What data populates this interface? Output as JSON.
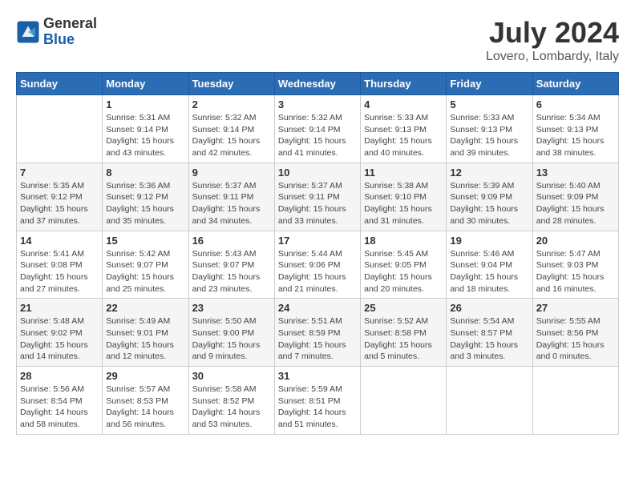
{
  "logo": {
    "general": "General",
    "blue": "Blue"
  },
  "title": {
    "month_year": "July 2024",
    "location": "Lovero, Lombardy, Italy"
  },
  "headers": [
    "Sunday",
    "Monday",
    "Tuesday",
    "Wednesday",
    "Thursday",
    "Friday",
    "Saturday"
  ],
  "weeks": [
    [
      {
        "day": "",
        "info": ""
      },
      {
        "day": "1",
        "info": "Sunrise: 5:31 AM\nSunset: 9:14 PM\nDaylight: 15 hours\nand 43 minutes."
      },
      {
        "day": "2",
        "info": "Sunrise: 5:32 AM\nSunset: 9:14 PM\nDaylight: 15 hours\nand 42 minutes."
      },
      {
        "day": "3",
        "info": "Sunrise: 5:32 AM\nSunset: 9:14 PM\nDaylight: 15 hours\nand 41 minutes."
      },
      {
        "day": "4",
        "info": "Sunrise: 5:33 AM\nSunset: 9:13 PM\nDaylight: 15 hours\nand 40 minutes."
      },
      {
        "day": "5",
        "info": "Sunrise: 5:33 AM\nSunset: 9:13 PM\nDaylight: 15 hours\nand 39 minutes."
      },
      {
        "day": "6",
        "info": "Sunrise: 5:34 AM\nSunset: 9:13 PM\nDaylight: 15 hours\nand 38 minutes."
      }
    ],
    [
      {
        "day": "7",
        "info": "Sunrise: 5:35 AM\nSunset: 9:12 PM\nDaylight: 15 hours\nand 37 minutes."
      },
      {
        "day": "8",
        "info": "Sunrise: 5:36 AM\nSunset: 9:12 PM\nDaylight: 15 hours\nand 35 minutes."
      },
      {
        "day": "9",
        "info": "Sunrise: 5:37 AM\nSunset: 9:11 PM\nDaylight: 15 hours\nand 34 minutes."
      },
      {
        "day": "10",
        "info": "Sunrise: 5:37 AM\nSunset: 9:11 PM\nDaylight: 15 hours\nand 33 minutes."
      },
      {
        "day": "11",
        "info": "Sunrise: 5:38 AM\nSunset: 9:10 PM\nDaylight: 15 hours\nand 31 minutes."
      },
      {
        "day": "12",
        "info": "Sunrise: 5:39 AM\nSunset: 9:09 PM\nDaylight: 15 hours\nand 30 minutes."
      },
      {
        "day": "13",
        "info": "Sunrise: 5:40 AM\nSunset: 9:09 PM\nDaylight: 15 hours\nand 28 minutes."
      }
    ],
    [
      {
        "day": "14",
        "info": "Sunrise: 5:41 AM\nSunset: 9:08 PM\nDaylight: 15 hours\nand 27 minutes."
      },
      {
        "day": "15",
        "info": "Sunrise: 5:42 AM\nSunset: 9:07 PM\nDaylight: 15 hours\nand 25 minutes."
      },
      {
        "day": "16",
        "info": "Sunrise: 5:43 AM\nSunset: 9:07 PM\nDaylight: 15 hours\nand 23 minutes."
      },
      {
        "day": "17",
        "info": "Sunrise: 5:44 AM\nSunset: 9:06 PM\nDaylight: 15 hours\nand 21 minutes."
      },
      {
        "day": "18",
        "info": "Sunrise: 5:45 AM\nSunset: 9:05 PM\nDaylight: 15 hours\nand 20 minutes."
      },
      {
        "day": "19",
        "info": "Sunrise: 5:46 AM\nSunset: 9:04 PM\nDaylight: 15 hours\nand 18 minutes."
      },
      {
        "day": "20",
        "info": "Sunrise: 5:47 AM\nSunset: 9:03 PM\nDaylight: 15 hours\nand 16 minutes."
      }
    ],
    [
      {
        "day": "21",
        "info": "Sunrise: 5:48 AM\nSunset: 9:02 PM\nDaylight: 15 hours\nand 14 minutes."
      },
      {
        "day": "22",
        "info": "Sunrise: 5:49 AM\nSunset: 9:01 PM\nDaylight: 15 hours\nand 12 minutes."
      },
      {
        "day": "23",
        "info": "Sunrise: 5:50 AM\nSunset: 9:00 PM\nDaylight: 15 hours\nand 9 minutes."
      },
      {
        "day": "24",
        "info": "Sunrise: 5:51 AM\nSunset: 8:59 PM\nDaylight: 15 hours\nand 7 minutes."
      },
      {
        "day": "25",
        "info": "Sunrise: 5:52 AM\nSunset: 8:58 PM\nDaylight: 15 hours\nand 5 minutes."
      },
      {
        "day": "26",
        "info": "Sunrise: 5:54 AM\nSunset: 8:57 PM\nDaylight: 15 hours\nand 3 minutes."
      },
      {
        "day": "27",
        "info": "Sunrise: 5:55 AM\nSunset: 8:56 PM\nDaylight: 15 hours\nand 0 minutes."
      }
    ],
    [
      {
        "day": "28",
        "info": "Sunrise: 5:56 AM\nSunset: 8:54 PM\nDaylight: 14 hours\nand 58 minutes."
      },
      {
        "day": "29",
        "info": "Sunrise: 5:57 AM\nSunset: 8:53 PM\nDaylight: 14 hours\nand 56 minutes."
      },
      {
        "day": "30",
        "info": "Sunrise: 5:58 AM\nSunset: 8:52 PM\nDaylight: 14 hours\nand 53 minutes."
      },
      {
        "day": "31",
        "info": "Sunrise: 5:59 AM\nSunset: 8:51 PM\nDaylight: 14 hours\nand 51 minutes."
      },
      {
        "day": "",
        "info": ""
      },
      {
        "day": "",
        "info": ""
      },
      {
        "day": "",
        "info": ""
      }
    ]
  ]
}
